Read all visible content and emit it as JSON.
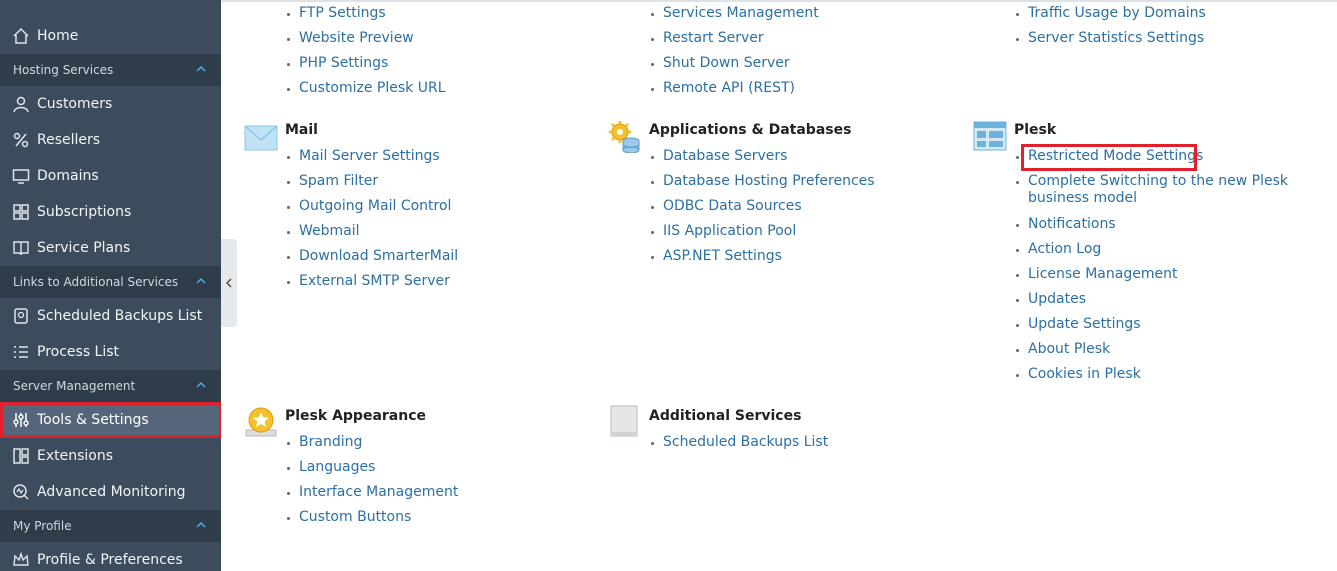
{
  "sidebar": {
    "home": "Home",
    "sections": {
      "hosting": "Hosting Services",
      "links": "Links to Additional Services",
      "server": "Server Management",
      "profile": "My Profile"
    },
    "items": {
      "customers": "Customers",
      "resellers": "Resellers",
      "domains": "Domains",
      "subscriptions": "Subscriptions",
      "service_plans": "Service Plans",
      "scheduled_backups": "Scheduled Backups List",
      "process_list": "Process List",
      "tools_settings": "Tools & Settings",
      "extensions": "Extensions",
      "advanced_monitoring": "Advanced Monitoring",
      "profile_prefs": "Profile & Preferences"
    }
  },
  "columns": {
    "col1_top": [
      "FTP Settings",
      "Website Preview",
      "PHP Settings",
      "Customize Plesk URL"
    ],
    "col2_top": [
      "Services Management",
      "Restart Server",
      "Shut Down Server",
      "Remote API (REST)"
    ],
    "col3_top": [
      "Traffic Usage by Domains",
      "Server Statistics Settings"
    ]
  },
  "groups": {
    "mail": {
      "title": "Mail",
      "links": [
        "Mail Server Settings",
        "Spam Filter",
        "Outgoing Mail Control",
        "Webmail",
        "Download SmarterMail",
        "External SMTP Server"
      ]
    },
    "apps": {
      "title": "Applications & Databases",
      "links": [
        "Database Servers",
        "Database Hosting Preferences",
        "ODBC Data Sources",
        "IIS Application Pool",
        "ASP.NET Settings"
      ]
    },
    "plesk": {
      "title": "Plesk",
      "links": [
        "Restricted Mode Settings",
        "Complete Switching to the new Plesk business model",
        "Notifications",
        "Action Log",
        "License Management",
        "Updates",
        "Update Settings",
        "About Plesk",
        "Cookies in Plesk"
      ]
    },
    "appearance": {
      "title": "Plesk Appearance",
      "links": [
        "Branding",
        "Languages",
        "Interface Management",
        "Custom Buttons"
      ]
    },
    "additional": {
      "title": "Additional Services",
      "links": [
        "Scheduled Backups List"
      ]
    }
  },
  "icons": {
    "home": "home-icon",
    "customers": "user-icon",
    "resellers": "percent-icon",
    "domains": "monitor-icon",
    "subscriptions": "grid-icon",
    "service_plans": "book-icon",
    "scheduled_backups": "backup-icon",
    "process_list": "list-icon",
    "tools": "sliders-icon",
    "extensions": "extensions-icon",
    "monitoring": "monitoring-icon",
    "profile": "crown-icon"
  },
  "colors": {
    "sidebar_bg": "#3d4c5c",
    "section_bg": "#2f3d4a",
    "link": "#2b6fa3",
    "highlight": "#e0202a"
  }
}
